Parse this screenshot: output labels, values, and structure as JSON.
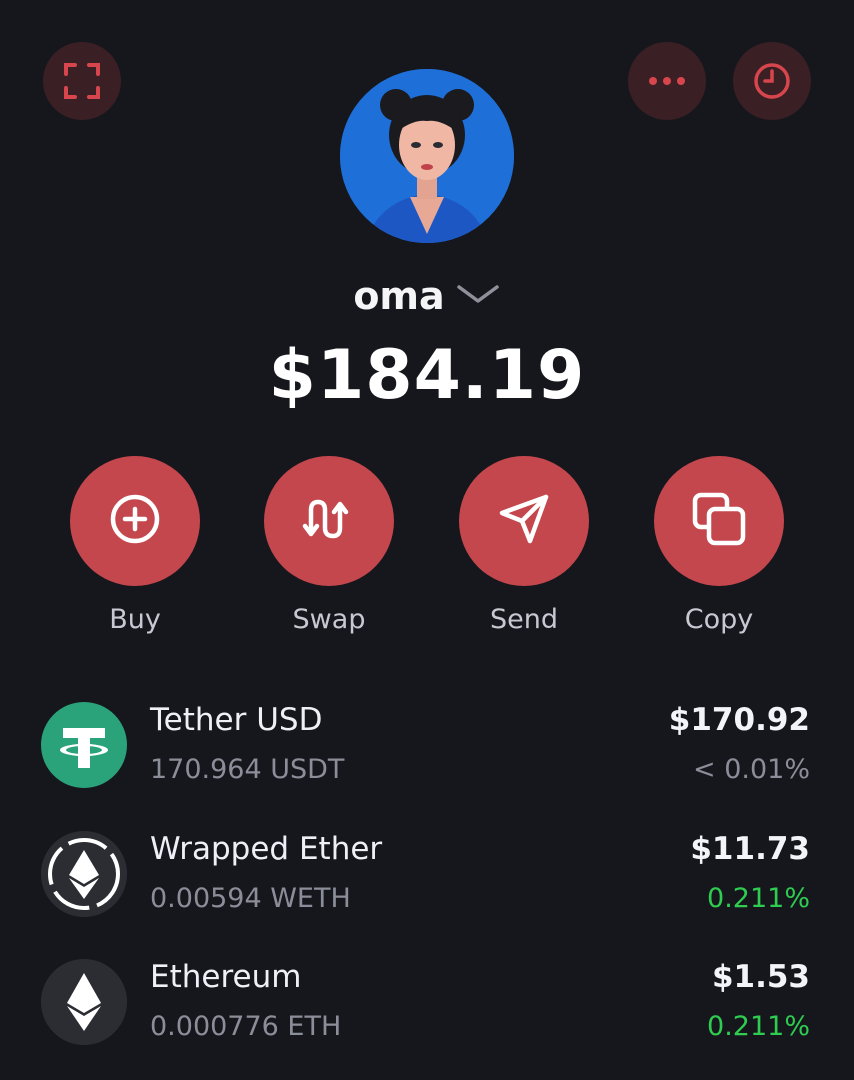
{
  "header": {
    "scan_icon": "scan-icon",
    "more_icon": "more-icon",
    "history_icon": "history-icon"
  },
  "account": {
    "name": "oma",
    "balance": "$184.19"
  },
  "actions": [
    {
      "label": "Buy",
      "icon": "plus-circle-icon"
    },
    {
      "label": "Swap",
      "icon": "swap-icon"
    },
    {
      "label": "Send",
      "icon": "send-icon"
    },
    {
      "label": "Copy",
      "icon": "copy-icon"
    }
  ],
  "assets": [
    {
      "name": "Tether USD",
      "amount": "170.964 USDT",
      "value": "$170.92",
      "change": "< 0.01%",
      "change_color": "#8b8e99",
      "icon": "tether-icon"
    },
    {
      "name": "Wrapped Ether",
      "amount": "0.00594 WETH",
      "value": "$11.73",
      "change": "0.211%",
      "change_color": "#2ecc4f",
      "icon": "weth-icon"
    },
    {
      "name": "Ethereum",
      "amount": "0.000776 ETH",
      "value": "$1.53",
      "change": "0.211%",
      "change_color": "#2ecc4f",
      "icon": "ethereum-icon"
    }
  ],
  "colors": {
    "background": "#16171d",
    "accent": "#c3474d",
    "top_button_bg": "#3a1f24",
    "positive": "#2ecc4f"
  }
}
